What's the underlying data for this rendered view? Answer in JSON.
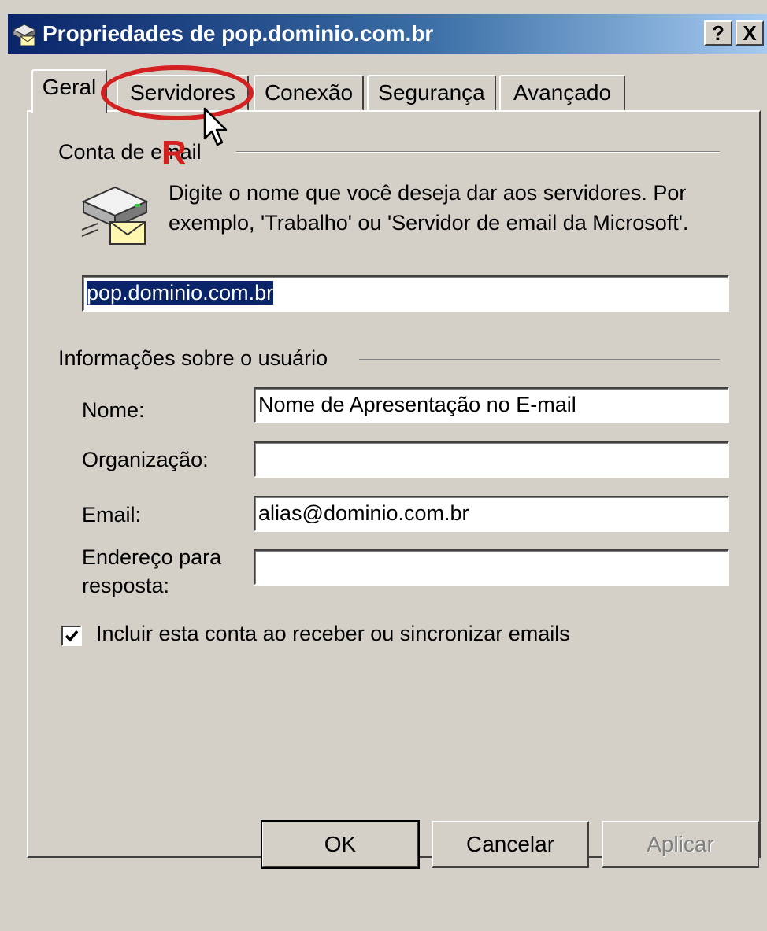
{
  "window": {
    "title": "Propriedades de pop.dominio.com.br",
    "help_label": "?",
    "close_label": "X"
  },
  "tabs": [
    {
      "label": "Geral",
      "active": true
    },
    {
      "label": "Servidores",
      "active": false
    },
    {
      "label": "Conexão",
      "active": false
    },
    {
      "label": "Segurança",
      "active": false
    },
    {
      "label": "Avançado",
      "active": false
    }
  ],
  "account": {
    "group_label": "Conta de email",
    "description": "Digite o nome que você deseja dar aos servidores. Por exemplo, 'Trabalho' ou 'Servidor de email da Microsoft'.",
    "account_name": "pop.dominio.com.br"
  },
  "user_info": {
    "group_label": "Informações sobre o usuário",
    "name_label": "Nome:",
    "name_value": "Nome de Apresentação no E-mail",
    "org_label": "Organização:",
    "org_value": "",
    "email_label": "Email:",
    "email_value": "alias@dominio.com.br",
    "reply_label_1": "Endereço para",
    "reply_label_2": "resposta:",
    "reply_value": ""
  },
  "include_checkbox": {
    "label": "Incluir esta conta ao receber ou sincronizar emails",
    "checked": true
  },
  "buttons": {
    "ok": "OK",
    "cancel": "Cancelar",
    "apply": "Aplicar"
  },
  "annotation": {
    "letter": "R",
    "color": "#d32020"
  },
  "colors": {
    "title_start": "#0a246a",
    "title_end": "#a6caf0",
    "dialog_bg": "#d4d0c8",
    "selection": "#0a246a"
  },
  "icons": {
    "title": "mail-server-icon",
    "account": "mail-server-icon",
    "cursor": "mouse-pointer-icon"
  }
}
